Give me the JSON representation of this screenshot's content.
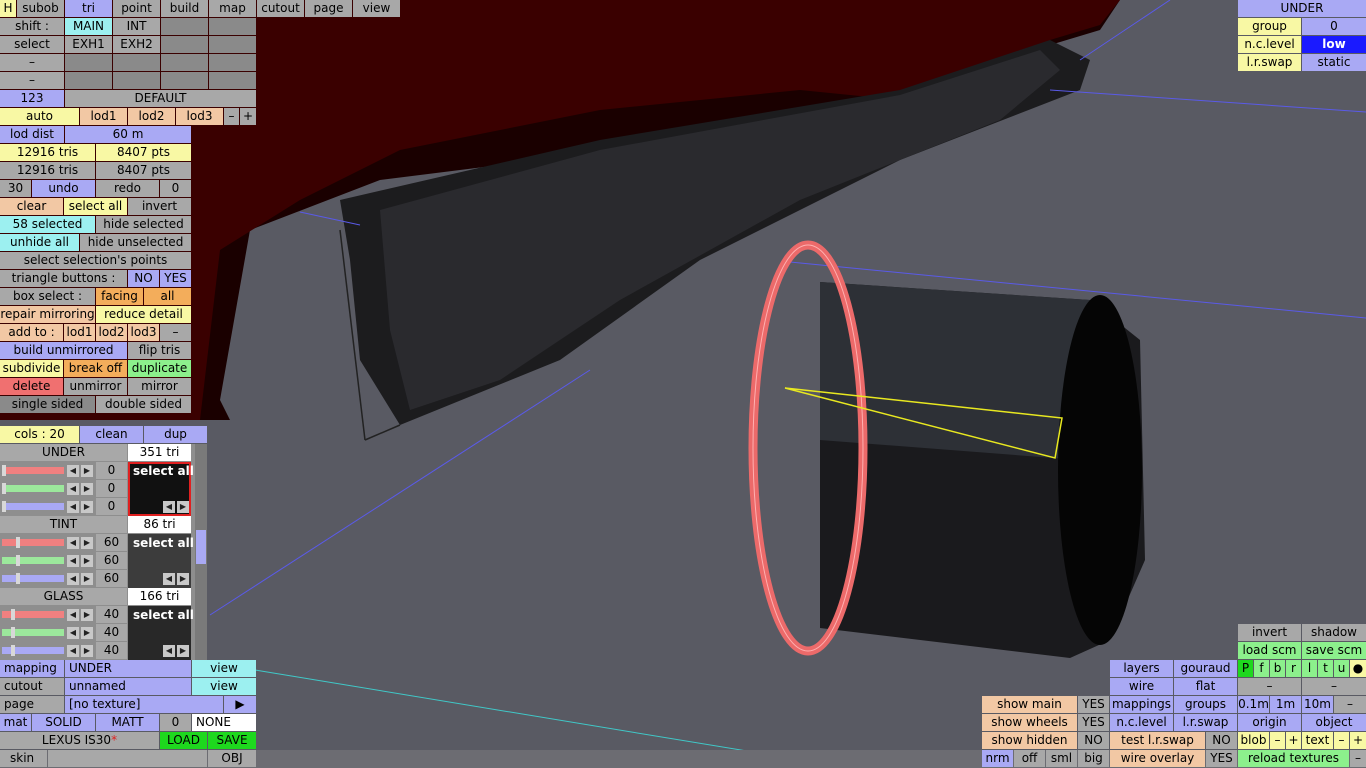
{
  "toolbar": {
    "h": "H",
    "subob": "subob",
    "tri": "tri",
    "point": "point",
    "build": "build",
    "map": "map",
    "cutout": "cutout",
    "page": "page",
    "view": "view"
  },
  "shift": {
    "label": "shift :",
    "main": "MAIN",
    "int": "INT"
  },
  "select_row": {
    "label": "select",
    "exh1": "EXH1",
    "exh2": "EXH2"
  },
  "dash": "–",
  "num123": "123",
  "default": "DEFAULT",
  "lod": {
    "auto": "auto",
    "lod1": "lod1",
    "lod2": "lod2",
    "lod3": "lod3",
    "minus": "–",
    "plus": "+"
  },
  "lod_dist": {
    "label": "lod dist",
    "value": "60 m"
  },
  "stats": {
    "tris1": "12916 tris",
    "pts1": "8407 pts",
    "tris2": "12916 tris",
    "pts2": "8407 pts"
  },
  "undo": {
    "count": "30",
    "undo": "undo",
    "redo": "redo",
    "redo_count": "0"
  },
  "sel": {
    "clear": "clear",
    "select_all": "select all",
    "invert": "invert"
  },
  "selected": {
    "count": "58 selected",
    "hide_selected": "hide selected",
    "unhide_all": "unhide all",
    "hide_unselected": "hide unselected",
    "select_points": "select selection's points"
  },
  "tri_buttons": {
    "label": "triangle buttons :",
    "no": "NO",
    "yes": "YES"
  },
  "box_select": {
    "label": "box select :",
    "facing": "facing",
    "all": "all"
  },
  "repair": {
    "repair": "repair mirroring",
    "reduce": "reduce detail"
  },
  "add_to": {
    "label": "add to :",
    "lod1": "lod1",
    "lod2": "lod2",
    "lod3": "lod3",
    "minus": "–"
  },
  "ops": {
    "build_unmirrored": "build unmirrored",
    "flip_tris": "flip tris",
    "subdivide": "subdivide",
    "break_off": "break off",
    "duplicate": "duplicate",
    "delete": "delete",
    "unmirror": "unmirror",
    "mirror": "mirror",
    "single_sided": "single sided",
    "double_sided": "double sided"
  },
  "cols": {
    "label": "cols : 20",
    "clean": "clean",
    "dup": "dup"
  },
  "colors": [
    {
      "name": "UNDER",
      "tris": "351 tri",
      "values": [
        "0",
        "0",
        "0"
      ],
      "select_all": "select all",
      "levels": [
        0,
        0,
        0
      ]
    },
    {
      "name": "TINT",
      "tris": "86 tri",
      "values": [
        "60",
        "60",
        "60"
      ],
      "select_all": "select all",
      "levels": [
        0.24,
        0.24,
        0.24
      ]
    },
    {
      "name": "GLASS",
      "tris": "166 tri",
      "values": [
        "40",
        "40",
        "40"
      ],
      "select_all": "select all",
      "levels": [
        0.16,
        0.16,
        0.16
      ]
    }
  ],
  "mapping": {
    "label": "mapping",
    "value": "UNDER",
    "view": "view"
  },
  "cutout": {
    "label": "cutout",
    "value": "unnamed",
    "view": "view"
  },
  "page_row": {
    "label": "page",
    "value": "[no texture]",
    "arrow": "▶"
  },
  "mat": {
    "label": "mat",
    "solid": "SOLID",
    "matt": "MATT",
    "num": "0",
    "none": "NONE"
  },
  "car": {
    "name": "LEXUS IS30",
    "star": "*",
    "load": "LOAD",
    "save": "SAVE"
  },
  "skin": {
    "label": "skin",
    "obj": "OBJ"
  },
  "top_right": {
    "title": "UNDER",
    "group_label": "group",
    "group_value": "0",
    "nc_label": "n.c.level",
    "nc_value": "low",
    "lr_label": "l.r.swap",
    "lr_value": "static"
  },
  "bottom_right": {
    "invert": "invert",
    "shadow": "shadow",
    "load_scm": "load scm",
    "save_scm": "save scm",
    "layers": "layers",
    "gouraud": "gouraud",
    "toggles": [
      "P",
      "f",
      "b",
      "r",
      "l",
      "t",
      "u",
      "●"
    ],
    "wire": "wire",
    "flat": "flat",
    "minus": "–",
    "mappings": "mappings",
    "groups": "groups",
    "d01": "0.1m",
    "d1": "1m",
    "d10": "10m",
    "nc_level": "n.c.level",
    "lr_swap": "l.r.swap",
    "origin": "origin",
    "object": "object",
    "test_lr": "test l.r.swap",
    "test_no": "NO",
    "blob": "blob",
    "text": "text",
    "plus": "+",
    "wire_overlay": "wire overlay",
    "wire_yes": "YES",
    "reload": "reload textures",
    "show_main": "show main",
    "show_main_v": "YES",
    "show_wheels": "show wheels",
    "show_wheels_v": "YES",
    "show_hidden": "show hidden",
    "show_hidden_v": "NO",
    "nrm": "nrm",
    "off": "off",
    "sml": "sml",
    "big": "big"
  }
}
